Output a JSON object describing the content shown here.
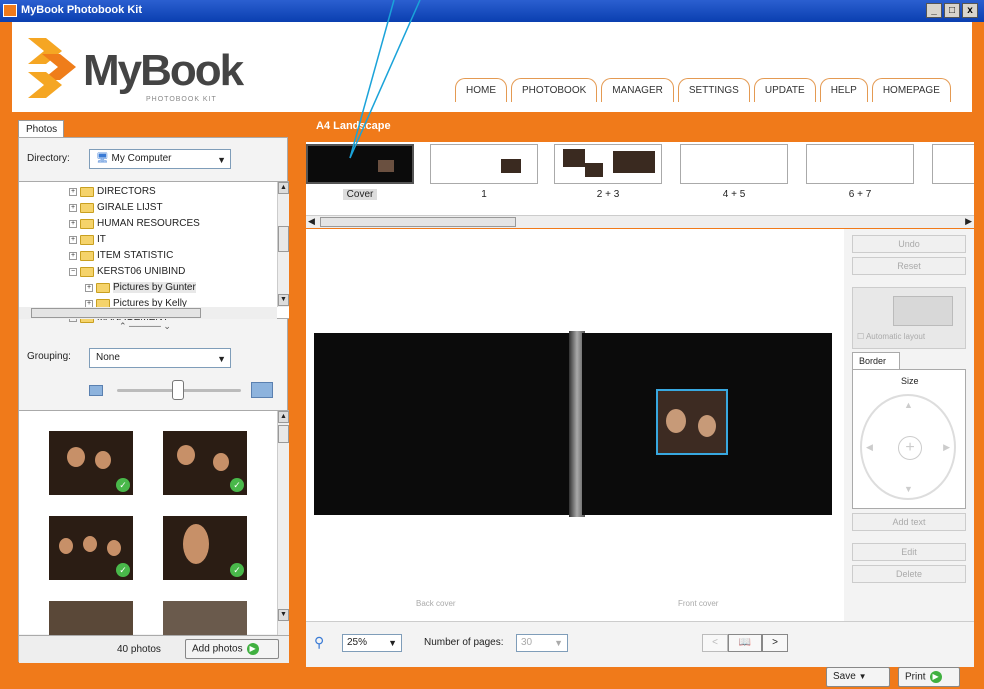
{
  "window": {
    "title": "MyBook Photobook Kit",
    "controls": [
      "_",
      "□",
      "x"
    ]
  },
  "logo": {
    "brand": "MyBook",
    "tagline": "PHOTOBOOK KIT"
  },
  "nav": [
    "HOME",
    "PHOTOBOOK",
    "MANAGER",
    "SETTINGS",
    "UPDATE",
    "HELP",
    "HOMEPAGE"
  ],
  "left": {
    "tab": "Photos",
    "directory_label": "Directory:",
    "directory_value": "My Computer",
    "tree": [
      {
        "label": "DIRECTORS",
        "indent": 0
      },
      {
        "label": "GIRALE LIJST",
        "indent": 0
      },
      {
        "label": "HUMAN RESOURCES",
        "indent": 0
      },
      {
        "label": "IT",
        "indent": 0
      },
      {
        "label": "ITEM STATISTIC",
        "indent": 0
      },
      {
        "label": "KERST06 UNIBIND",
        "indent": 0
      },
      {
        "label": "Pictures by Gunter",
        "indent": 1
      },
      {
        "label": "Pictures by Kelly",
        "indent": 1
      },
      {
        "label": "MANAGEMENT",
        "indent": 0
      }
    ],
    "grouping_label": "Grouping:",
    "grouping_value": "None",
    "photo_count": "40 photos",
    "add_photos": "Add photos"
  },
  "editor": {
    "format_title": "A4 Landscape",
    "pages": [
      "Cover",
      "1",
      "2 + 3",
      "4 + 5",
      "6 + 7"
    ],
    "back_cover": "Back cover",
    "front_cover": "Front cover",
    "zoom": "25%",
    "pages_label": "Number of pages:",
    "pages_value": "30"
  },
  "tools": {
    "undo": "Undo",
    "reset": "Reset",
    "automatic_layout": "Automatic layout",
    "border_tab": "Border",
    "size_label": "Size",
    "add_text": "Add text",
    "edit": "Edit",
    "delete": "Delete"
  },
  "footer": {
    "save": "Save",
    "print": "Print"
  }
}
